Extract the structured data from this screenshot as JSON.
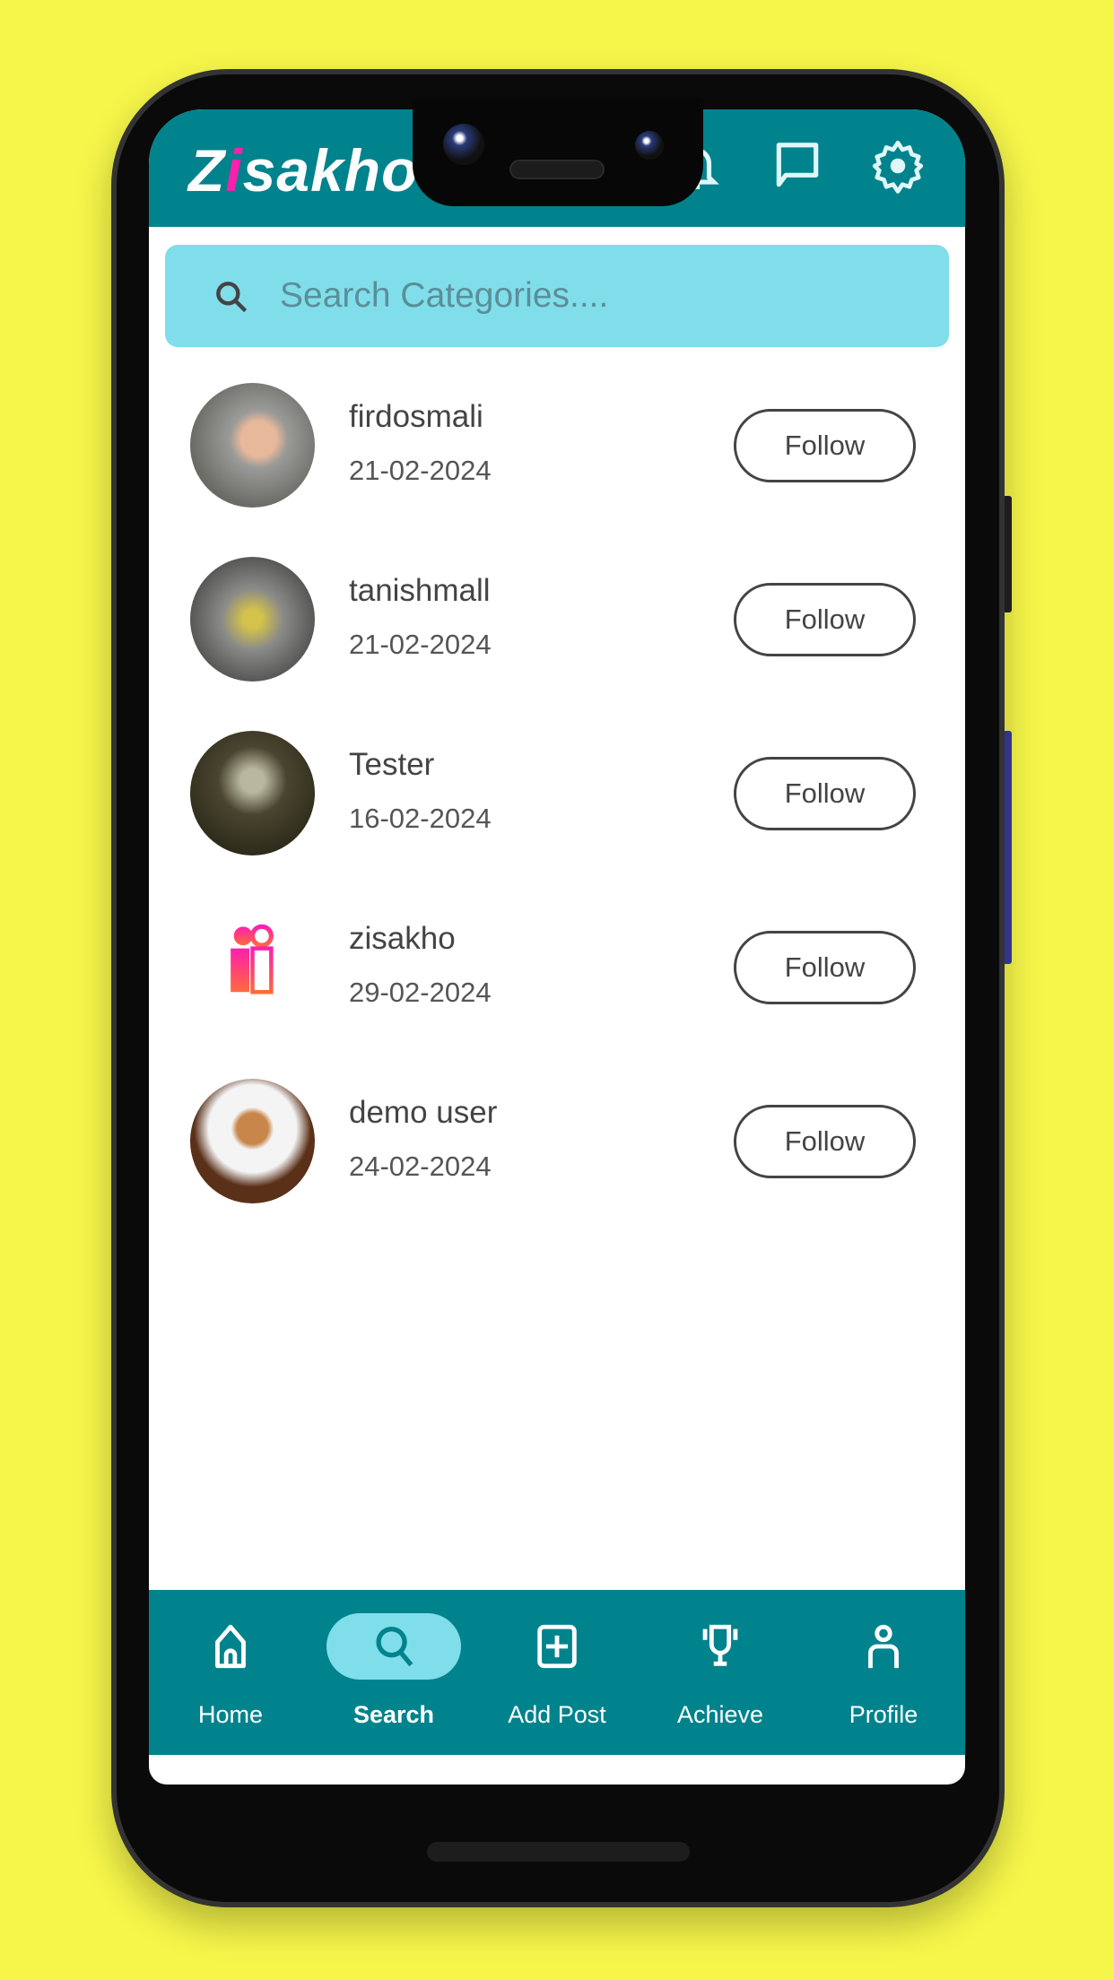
{
  "app": {
    "logo_text": "Zisakho",
    "accent": "#00838c",
    "search_highlight": "#80deea",
    "logo_pink": "#ff1fae"
  },
  "header": {
    "icons": [
      "bell-icon",
      "chat-icon",
      "settings-icon"
    ]
  },
  "search": {
    "placeholder": "Search Categories....",
    "value": ""
  },
  "users": [
    {
      "name": "firdosmali",
      "date": "21-02-2024",
      "follow_label": "Follow"
    },
    {
      "name": "tanishmall",
      "date": "21-02-2024",
      "follow_label": "Follow"
    },
    {
      "name": "Tester",
      "date": "16-02-2024",
      "follow_label": "Follow"
    },
    {
      "name": "zisakho",
      "date": "29-02-2024",
      "follow_label": "Follow"
    },
    {
      "name": "demo user",
      "date": "24-02-2024",
      "follow_label": "Follow"
    }
  ],
  "nav": {
    "items": [
      {
        "label": "Home",
        "icon": "home-icon"
      },
      {
        "label": "Search",
        "icon": "search-icon",
        "active": true
      },
      {
        "label": "Add Post",
        "icon": "add-box-icon"
      },
      {
        "label": "Achieve",
        "icon": "trophy-icon"
      },
      {
        "label": "Profile",
        "icon": "person-icon"
      }
    ]
  }
}
